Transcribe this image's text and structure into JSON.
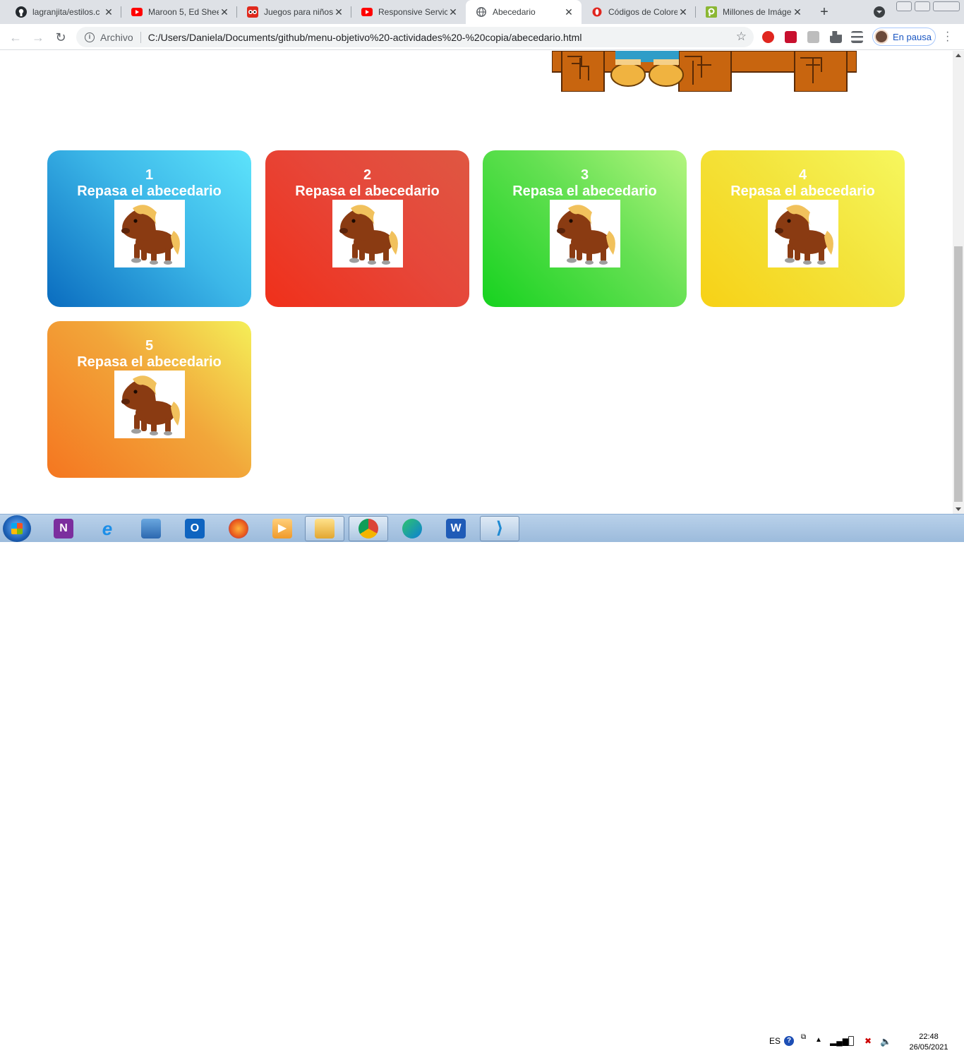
{
  "browser": {
    "tabs": [
      {
        "title": "lagranjita/estilos.c",
        "favicon": "github-icon"
      },
      {
        "title": "Maroon 5, Ed Shee",
        "favicon": "youtube-icon"
      },
      {
        "title": "Juegos para niños",
        "favicon": "owl-icon"
      },
      {
        "title": "Responsive Service",
        "favicon": "youtube-icon"
      },
      {
        "title": "Abecedario",
        "favicon": "globe-icon",
        "active": true
      },
      {
        "title": "Códigos de Colore",
        "favicon": "opera-icon"
      },
      {
        "title": "Millones de Imáge",
        "favicon": "pixabay-icon"
      }
    ],
    "new_tab": "+",
    "address": {
      "protocol_label": "Archivo",
      "url": "C:/Users/Daniela/Documents/github/menu-objetivo%20-actividades%20-%20copia/abecedario.html"
    },
    "profile_label": "En pausa"
  },
  "page": {
    "cards": [
      {
        "number": "1",
        "label": "Repasa el abecedario",
        "color": "#2fa8e0"
      },
      {
        "number": "2",
        "label": "Repasa el abecedario",
        "color": "#e33b2b"
      },
      {
        "number": "3",
        "label": "Repasa el abecedario",
        "color": "#4fde3c"
      },
      {
        "number": "4",
        "label": "Repasa el abecedario",
        "color": "#f4e235"
      },
      {
        "number": "5",
        "label": "Repasa el abecedario",
        "color": "#f2a13a"
      }
    ]
  },
  "taskbar": {
    "apps": [
      "onenote-icon",
      "internet-explorer-icon",
      "control-panel-icon",
      "outlook-icon",
      "firefox-icon",
      "media-player-icon",
      "file-explorer-icon",
      "chrome-icon",
      "edge-icon",
      "word-icon",
      "vscode-icon"
    ],
    "language": "ES",
    "time": "22:48",
    "date": "26/05/2021"
  }
}
